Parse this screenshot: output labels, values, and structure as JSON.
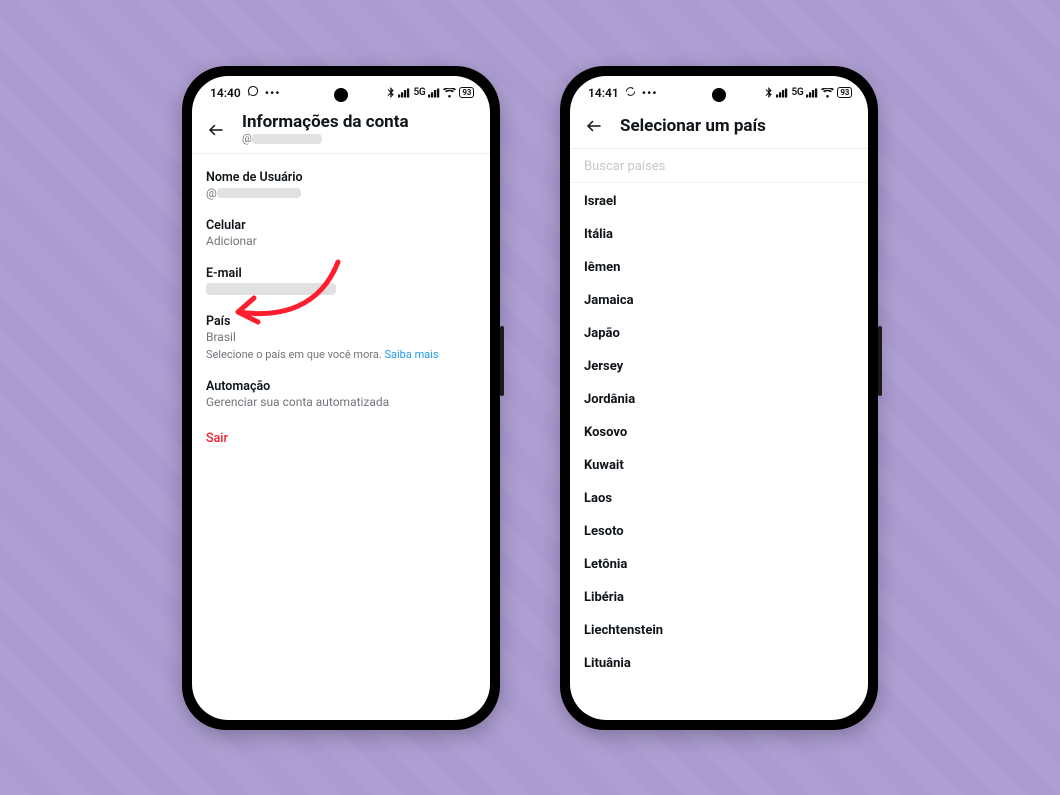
{
  "phone1": {
    "status": {
      "time": "14:40",
      "network_label": "5G",
      "battery_text": "93"
    },
    "header": {
      "title": "Informações da conta",
      "subtitle_prefix": "@"
    },
    "rows": {
      "username": {
        "label": "Nome de Usuário",
        "value_prefix": "@"
      },
      "phone": {
        "label": "Celular",
        "value": "Adicionar"
      },
      "email": {
        "label": "E-mail"
      },
      "country": {
        "label": "País",
        "value": "Brasil",
        "hint_text": "Selecione o país em que você mora.",
        "hint_link": "Saiba mais"
      },
      "automation": {
        "label": "Automação",
        "value": "Gerenciar sua conta automatizada"
      }
    },
    "logout": "Sair"
  },
  "phone2": {
    "status": {
      "time": "14:41",
      "network_label": "5G",
      "battery_text": "93"
    },
    "header": {
      "title": "Selecionar um país"
    },
    "search_placeholder": "Buscar países",
    "countries": [
      "Israel",
      "Itália",
      "Iêmen",
      "Jamaica",
      "Japão",
      "Jersey",
      "Jordânia",
      "Kosovo",
      "Kuwait",
      "Laos",
      "Lesoto",
      "Letônia",
      "Libéria",
      "Liechtenstein",
      "Lituânia"
    ]
  },
  "colors": {
    "accent_link": "#1d9bf0",
    "danger": "#f4212e",
    "annotation_arrow": "#ff1e2d",
    "background": "#ab9bd1"
  }
}
